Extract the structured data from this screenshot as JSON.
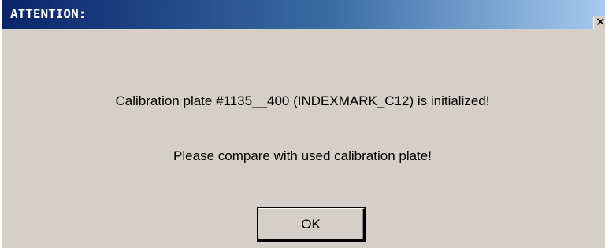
{
  "window": {
    "title": "ATTENTION:",
    "close_icon": "close-icon",
    "close_glyph": "✕"
  },
  "message": {
    "line1": "Calibration plate #1135__400 (INDEXMARK_C12) is initialized!",
    "line2": "Please compare with used calibration plate!"
  },
  "buttons": {
    "ok_label": "OK"
  },
  "colors": {
    "title_gradient_start": "#0a246a",
    "title_gradient_end": "#a6caf0",
    "dialog_background": "#d4d0c8",
    "title_text": "#ffffff"
  }
}
